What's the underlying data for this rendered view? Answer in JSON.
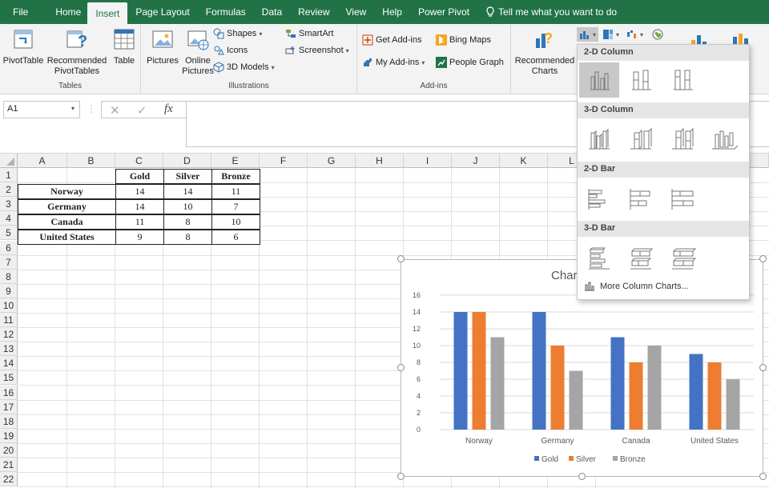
{
  "ribbon_tabs": [
    {
      "label": "File"
    },
    {
      "label": "Home"
    },
    {
      "label": "Insert"
    },
    {
      "label": "Page Layout"
    },
    {
      "label": "Formulas"
    },
    {
      "label": "Data"
    },
    {
      "label": "Review"
    },
    {
      "label": "View"
    },
    {
      "label": "Help"
    },
    {
      "label": "Power Pivot"
    }
  ],
  "tell_me": "Tell me what you want to do",
  "groups": {
    "tables": {
      "label": "Tables",
      "pivot": "PivotTable",
      "recommended": "Recommended PivotTables",
      "table": "Table"
    },
    "illustrations": {
      "label": "Illustrations",
      "pictures": "Pictures",
      "online": "Online Pictures",
      "shapes": "Shapes",
      "icons": "Icons",
      "models": "3D Models",
      "smartart": "SmartArt",
      "screenshot": "Screenshot"
    },
    "addins": {
      "label": "Add-ins",
      "get": "Get Add-ins",
      "my": "My Add-ins",
      "bing": "Bing Maps",
      "people": "People Graph"
    },
    "charts": {
      "recommended": "Recommended Charts"
    }
  },
  "name_box": "A1",
  "formula_fx": "fx",
  "columns": [
    "A",
    "B",
    "C",
    "D",
    "E",
    "F",
    "G",
    "H",
    "I",
    "J",
    "K",
    "L"
  ],
  "rows": [
    "1",
    "2",
    "3",
    "4",
    "5",
    "6",
    "7",
    "8",
    "9",
    "10",
    "11",
    "12",
    "13",
    "14",
    "15",
    "16",
    "17",
    "18",
    "19",
    "20",
    "21",
    "22"
  ],
  "table": {
    "headers": [
      "Gold",
      "Silver",
      "Bronze"
    ],
    "rows": [
      {
        "country": "Norway",
        "gold": "14",
        "silver": "14",
        "bronze": "11"
      },
      {
        "country": "Germany",
        "gold": "14",
        "silver": "10",
        "bronze": "7"
      },
      {
        "country": "Canada",
        "gold": "11",
        "silver": "8",
        "bronze": "10"
      },
      {
        "country": "United States",
        "gold": "9",
        "silver": "8",
        "bronze": "6"
      }
    ]
  },
  "gallery": {
    "section_2d_column": "2-D Column",
    "section_3d_column": "3-D Column",
    "section_2d_bar": "2-D Bar",
    "section_3d_bar": "3-D Bar",
    "more": "More Column Charts..."
  },
  "colors": {
    "excel_green": "#217346",
    "gold": "#4472C4",
    "silver": "#ED7D31",
    "bronze": "#A5A5A5"
  },
  "chart_data": {
    "type": "bar",
    "title": "Char",
    "categories": [
      "Norway",
      "Germany",
      "Canada",
      "United States"
    ],
    "series": [
      {
        "name": "Gold",
        "values": [
          14,
          14,
          11,
          9
        ]
      },
      {
        "name": "Silver",
        "values": [
          14,
          10,
          8,
          8
        ]
      },
      {
        "name": "Bronze",
        "values": [
          11,
          7,
          10,
          6
        ]
      }
    ],
    "ylim": [
      0,
      16
    ],
    "yticks": [
      0,
      2,
      4,
      6,
      8,
      10,
      12,
      14,
      16
    ],
    "grid": true,
    "legend": "bottom"
  }
}
